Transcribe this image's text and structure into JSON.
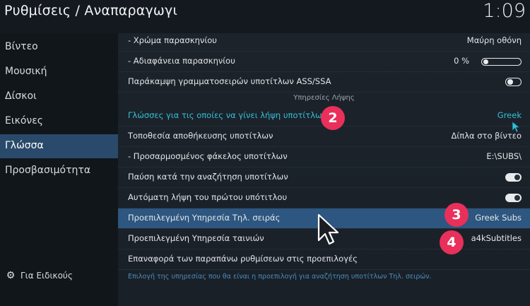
{
  "header": {
    "title": "Ρυθμίσεις / Αναπαραγωγι",
    "clock": "1:09"
  },
  "sidebar": {
    "items": [
      {
        "label": "Βίντεο"
      },
      {
        "label": "Μουσική"
      },
      {
        "label": "Δίσκοι"
      },
      {
        "label": "Εικόνες"
      },
      {
        "label": "Γλώσσα"
      },
      {
        "label": "Προσβασιμότητα"
      }
    ],
    "active": "Γλώσσα",
    "footer_label": "Για Ειδικούς",
    "footer_icon": "gear-icon"
  },
  "settings": {
    "bg_color": {
      "label": "- Χρώμα παρασκηνίου",
      "value": "Μαύρη οθόνη"
    },
    "bg_opacity": {
      "label": "- Αδιαφάνεια παρασκηνίου",
      "value": "0 %",
      "level_percent": 0
    },
    "override_fonts": {
      "label": "Παράκαμψη γραμματοσειρών υποτίτλων ASS/SSA",
      "enabled": false
    },
    "section_title": "Υπηρεσίες Λήψης",
    "download_languages": {
      "label": "Γλώσσες για τις οποίες να γίνει λήψη υποτίτλων",
      "value": "Greek"
    },
    "storage_location": {
      "label": "Τοποθεσία αποθήκευσης υποτίτλων",
      "value": "Δίπλα στο βίντεο"
    },
    "custom_folder": {
      "label": "- Προσαρμοσμένος φάκελος υποτίτλων",
      "value": "E:\\SUBS\\"
    },
    "pause_on_search": {
      "label": "Παύση κατά την αναζήτηση υποτίτλων",
      "enabled": true
    },
    "auto_download_first": {
      "label": "Αυτόματη λήψη του πρώτου υπότιτλου",
      "enabled": true
    },
    "default_tv_service": {
      "label": "Προεπιλεγμένη Υπηρεσία Τηλ. σειράς",
      "value": "Greek Subs"
    },
    "default_movie_service": {
      "label": "Προεπιλεγμένη Υπηρεσία ταινιών",
      "value": "a4kSubtitles"
    },
    "reset_defaults": {
      "label": "Επαναφορά των παραπάνω ρυθμίσεων στις προεπιλογές"
    }
  },
  "description": "Επιλογή της υπηρεσίας που θα είναι η προεπιλογή για αναζήτηση υποτίτλων Τηλ. σειρών.",
  "annotations": {
    "badge_2": "2",
    "badge_3": "3",
    "badge_4": "4"
  },
  "colors": {
    "accent": "#35c0d6",
    "highlight": "#2d5680",
    "sidebar_active": "#2a4a6b",
    "badge": "#e8305a",
    "description": "#4d8db8"
  }
}
